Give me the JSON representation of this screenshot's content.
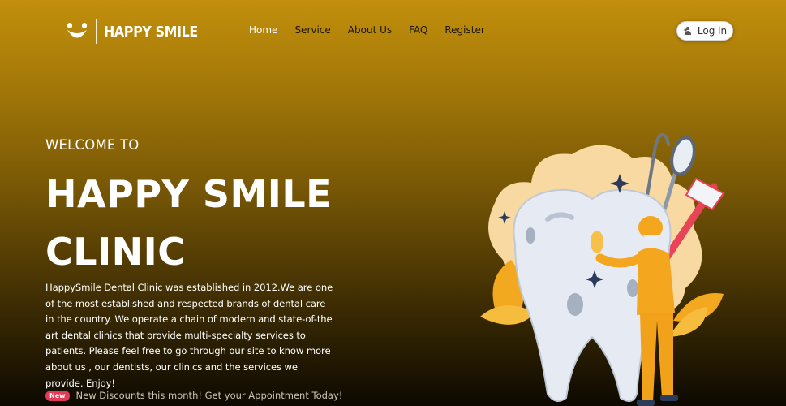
{
  "brand": {
    "name": "HAPPY SMILE",
    "logo_icon": "smile-logo-icon"
  },
  "nav": {
    "items": [
      {
        "label": "Home",
        "active": true
      },
      {
        "label": "Service",
        "active": false
      },
      {
        "label": "About Us",
        "active": false
      },
      {
        "label": "FAQ",
        "active": false
      },
      {
        "label": "Register",
        "active": false
      }
    ]
  },
  "header": {
    "login_label": "Log in",
    "login_icon": "login-arrow-icon"
  },
  "hero": {
    "welcome": "WELCOME TO",
    "title_line1": "HAPPY SMILE",
    "title_line2": "CLINIC",
    "description": "HappySmile Dental Clinic was established in 2012.We are one of the most established and respected brands of dental care in the country. We operate a chain of modern and state-of-the art dental clinics that provide multi-specialty services to patients. Please feel free to go through our site to know more about us , our dentists, our clinics and the services we provide. Enjoy!",
    "badge": "New",
    "promo": "New Discounts this month! Get your Appointment Today!"
  },
  "colors": {
    "background_top": "#c18f0c",
    "background_bottom": "#0d0901",
    "badge": "#e23a57",
    "nav_text": "#1c1404",
    "illustration_accent": "#f5a61f"
  }
}
